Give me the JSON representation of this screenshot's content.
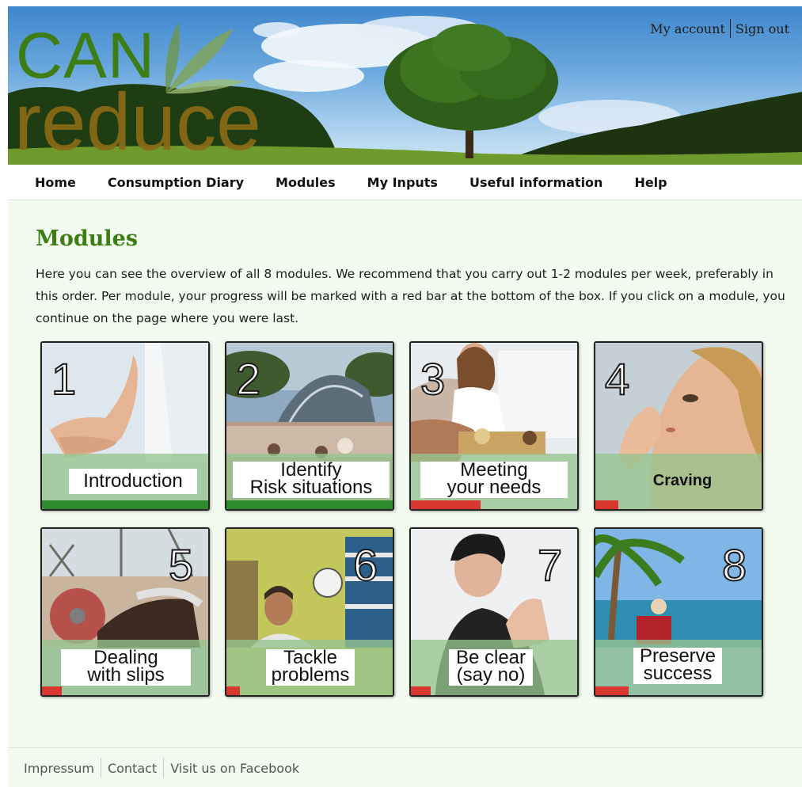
{
  "account": {
    "my_account": "My account",
    "sign_out": "Sign out"
  },
  "logo": {
    "line1": "CAN",
    "line2": "reduce"
  },
  "nav": {
    "items": [
      {
        "label": "Home"
      },
      {
        "label": "Consumption Diary"
      },
      {
        "label": "Modules"
      },
      {
        "label": "My Inputs"
      },
      {
        "label": "Useful information"
      },
      {
        "label": "Help"
      }
    ]
  },
  "page": {
    "title": "Modules",
    "intro": "Here you can see the overview of all 8 modules. We recommend that you carry out 1-2 modules per week, preferably in this order. Per module, your progress will be marked with a red bar at the bottom of the box. If you click on a module, you continue on the page where you were last."
  },
  "modules": [
    {
      "number": "1",
      "label": "Introduction",
      "progress": 1.0,
      "progress_color": "#2d8a2d"
    },
    {
      "number": "2",
      "label": "Identify\nRisk situations",
      "progress": 1.0,
      "progress_color": "#2d8a2d"
    },
    {
      "number": "3",
      "label": "Meeting\nyour needs",
      "progress": 0.42,
      "progress_color": "#d8372f"
    },
    {
      "number": "4",
      "label": "Craving",
      "progress": 0.14,
      "progress_color": "#d8372f"
    },
    {
      "number": "5",
      "label": "Dealing\nwith slips",
      "progress": 0.12,
      "progress_color": "#d8372f"
    },
    {
      "number": "6",
      "label": "Tackle\nproblems",
      "progress": 0.08,
      "progress_color": "#d8372f"
    },
    {
      "number": "7",
      "label": "Be clear\n(say no)",
      "progress": 0.12,
      "progress_color": "#d8372f"
    },
    {
      "number": "8",
      "label": "Preserve\nsuccess",
      "progress": 0.2,
      "progress_color": "#d8372f"
    }
  ],
  "footer": {
    "links": [
      "Impressum",
      "Contact",
      "Visit us on Facebook"
    ]
  },
  "colors": {
    "brand_green": "#3d7e14",
    "brand_brown": "#8a6a16",
    "done": "#2d8a2d",
    "in_progress": "#d8372f"
  }
}
